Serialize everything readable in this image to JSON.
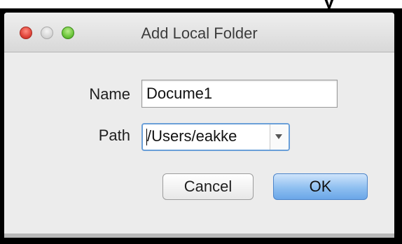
{
  "window": {
    "title": "Add Local Folder",
    "buttons": [
      "close",
      "minimize",
      "zoom"
    ]
  },
  "form": {
    "name_label": "Name",
    "name_value": "Docume1",
    "path_label": "Path",
    "path_value": "/Users/eakke"
  },
  "actions": {
    "cancel_label": "Cancel",
    "ok_label": "OK"
  },
  "icons": {
    "path_dropdown": "chevron-down-icon"
  },
  "colors": {
    "close": "#e0443a",
    "minimize": "#d8d8d8",
    "zoom": "#6cc53b",
    "default_button": "#8ebff0",
    "focus_ring": "#6a9fd8"
  }
}
